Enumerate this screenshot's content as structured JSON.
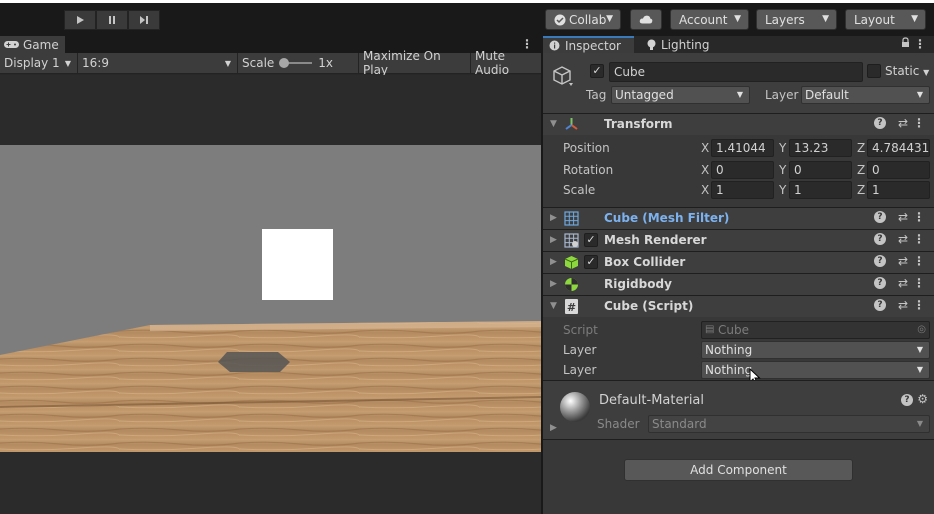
{
  "toolbar": {
    "play_icon": "play-icon",
    "pause_icon": "pause-icon",
    "step_icon": "step-icon",
    "collab_label": "Collab",
    "cloud_icon": "cloud-icon",
    "account_label": "Account",
    "layers_label": "Layers",
    "layout_label": "Layout"
  },
  "game": {
    "tab_label": "Game",
    "display_label": "Display 1",
    "aspect_label": "16:9",
    "scale_label": "Scale",
    "scale_value": "1x",
    "maximize_label": "Maximize On Play",
    "mute_label": "Mute Audio"
  },
  "inspector": {
    "tab_label": "Inspector",
    "lighting_tab_label": "Lighting",
    "object_name": "Cube",
    "static_label": "Static",
    "tag_label": "Tag",
    "tag_value": "Untagged",
    "layer_label": "Layer",
    "layer_value": "Default",
    "transform": {
      "title": "Transform",
      "position_label": "Position",
      "rotation_label": "Rotation",
      "scale_label": "Scale",
      "position": {
        "x": "1.41044",
        "y": "13.23",
        "z": "4.784431"
      },
      "rotation": {
        "x": "0",
        "y": "0",
        "z": "0"
      },
      "scale": {
        "x": "1",
        "y": "1",
        "z": "1"
      },
      "axis_x": "X",
      "axis_y": "Y",
      "axis_z": "Z"
    },
    "components": [
      {
        "name": "Cube (Mesh Filter)",
        "icon": "mesh-filter-icon"
      },
      {
        "name": "Mesh Renderer",
        "icon": "mesh-renderer-icon"
      },
      {
        "name": "Box Collider",
        "icon": "box-collider-icon"
      },
      {
        "name": "Rigidbody",
        "icon": "rigidbody-icon"
      },
      {
        "name": "Cube (Script)",
        "icon": "script-icon"
      }
    ],
    "script": {
      "script_label": "Script",
      "script_value": "Cube",
      "layer1_label": "Layer",
      "layer1_value": "Nothing",
      "layer2_label": "Layer",
      "layer2_value": "Nothing"
    },
    "material": {
      "name": "Default-Material",
      "shader_label": "Shader",
      "shader_value": "Standard"
    },
    "add_component_label": "Add Component"
  },
  "colors": {
    "accent_blue": "#3a79bb",
    "mesh_filter_name": "#7cb2ef",
    "sky": "#7d7d7d",
    "floor": "#b48b61"
  }
}
